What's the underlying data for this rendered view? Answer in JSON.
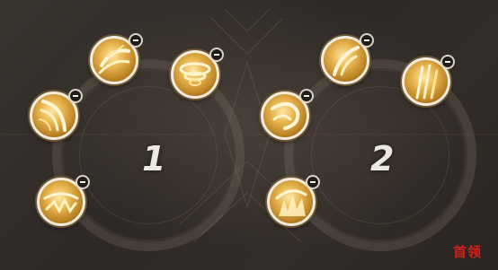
{
  "loadouts": [
    {
      "number": "1",
      "skills": [
        {
          "name": "skill-1-1",
          "icon": "wind-slash-icon"
        },
        {
          "name": "skill-1-2",
          "icon": "whirlwind-icon"
        },
        {
          "name": "skill-1-3",
          "icon": "feather-slash-icon"
        },
        {
          "name": "skill-1-4",
          "icon": "ground-wave-icon"
        }
      ]
    },
    {
      "number": "2",
      "skills": [
        {
          "name": "skill-2-1",
          "icon": "crescent-strike-icon"
        },
        {
          "name": "skill-2-2",
          "icon": "rising-blades-icon"
        },
        {
          "name": "skill-2-3",
          "icon": "spiral-slash-icon"
        },
        {
          "name": "skill-2-4",
          "icon": "flame-burst-icon"
        }
      ]
    }
  ],
  "watermark": "首领",
  "colors": {
    "skill_gold": "#e6b24c",
    "skill_border": "#f4ecdc",
    "number_text": "#ece7e1",
    "watermark_red": "#d4201a",
    "background": "#2e2926"
  }
}
